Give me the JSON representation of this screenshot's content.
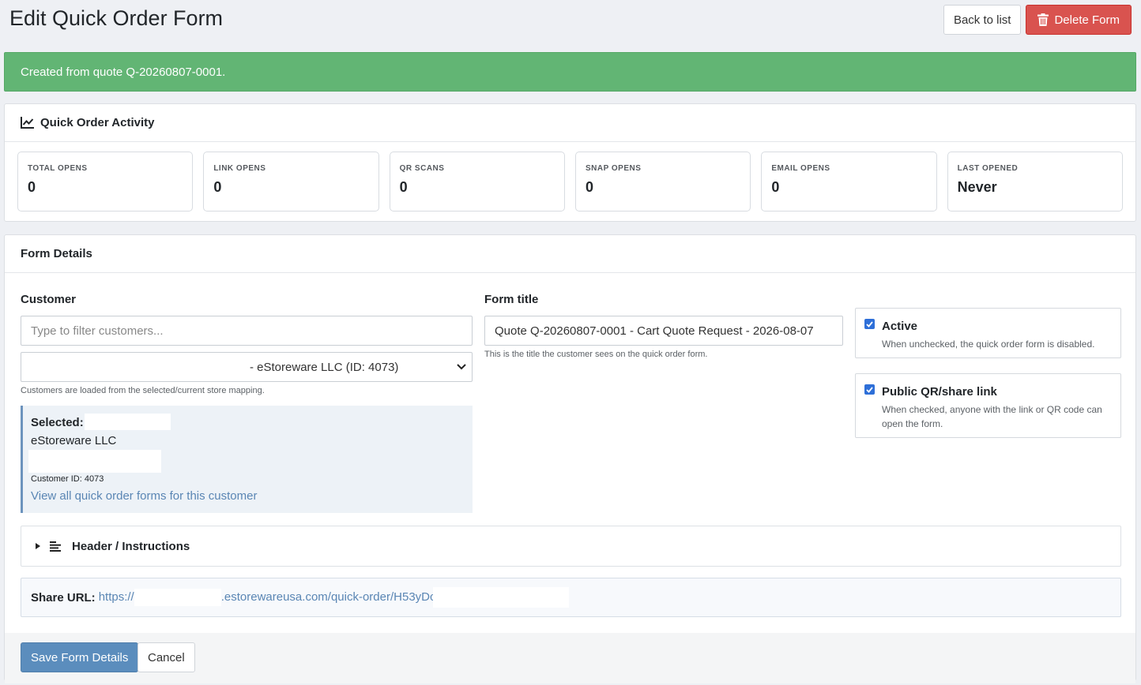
{
  "page": {
    "title": "Edit Quick Order Form",
    "back_label": "Back to list",
    "delete_label": "Delete Form"
  },
  "alert": {
    "message": "Created from quote Q-20260807-0001."
  },
  "activity": {
    "title": "Quick Order Activity",
    "stats": [
      {
        "label": "TOTAL OPENS",
        "value": "0"
      },
      {
        "label": "LINK OPENS",
        "value": "0"
      },
      {
        "label": "QR SCANS",
        "value": "0"
      },
      {
        "label": "SNAP OPENS",
        "value": "0"
      },
      {
        "label": "EMAIL OPENS",
        "value": "0"
      },
      {
        "label": "LAST OPENED",
        "value": "Never"
      }
    ]
  },
  "form": {
    "title": "Form Details",
    "customer_label": "Customer",
    "customer_filter_placeholder": "Type to filter customers...",
    "customer_select_value": "- eStoreware LLC (ID: 4073)",
    "customer_help": "Customers are loaded from the selected/current store mapping.",
    "selected_label": "Selected:",
    "selected_company": "eStoreware LLC",
    "selected_customer_id": "Customer ID: 4073",
    "view_all_link": "View all quick order forms for this customer",
    "form_title_label": "Form title",
    "form_title_value": "Quote Q-20260807-0001 - Cart Quote Request - 2026-08-07",
    "form_title_help": "This is the title the customer sees on the quick order form.",
    "active_label": "Active",
    "active_checked": true,
    "active_help": "When unchecked, the quick order form is disabled.",
    "public_label": "Public QR/share link",
    "public_checked": true,
    "public_help_1": "When checked, anyone with the link or QR code can",
    "public_help_2": "open the form.",
    "header_instructions_label": "Header / Instructions",
    "share_label": "Share URL:",
    "share_url_start": "https://",
    "share_url_rest": ".estorewareusa.com/quick-order/H53yDc",
    "save_label": "Save Form Details",
    "cancel_label": "Cancel"
  },
  "colors": {
    "success": "#62b574",
    "danger": "#d9534f",
    "primary": "#5b8dbd",
    "link": "#5a86b4"
  }
}
